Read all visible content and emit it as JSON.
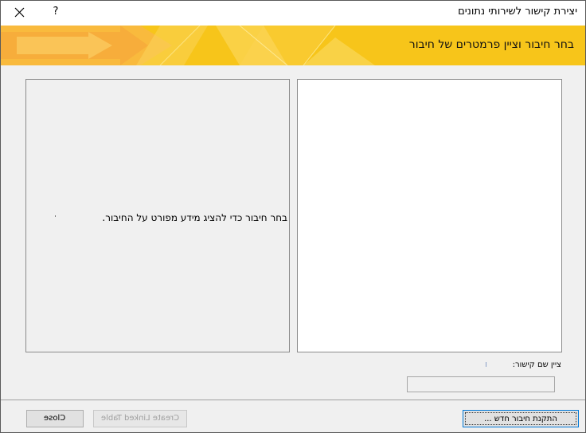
{
  "window": {
    "title": "יצירת קישור לשירותי נתונים",
    "help_label": "?"
  },
  "banner": {
    "heading": "בחר חיבור וציין פרמטרים של חיבור"
  },
  "details": {
    "message": "בחר חיבור כדי להציג מידע מפורט על החיבור."
  },
  "link_name": {
    "label": "ציין שם קישור:",
    "value": ""
  },
  "buttons": {
    "new_connection": "התקנת חיבור חדש ...",
    "create_linked_table": "Create Linked Table",
    "close": "Close"
  },
  "colors": {
    "banner": "#f7c51a",
    "accent": "#0078d7"
  }
}
